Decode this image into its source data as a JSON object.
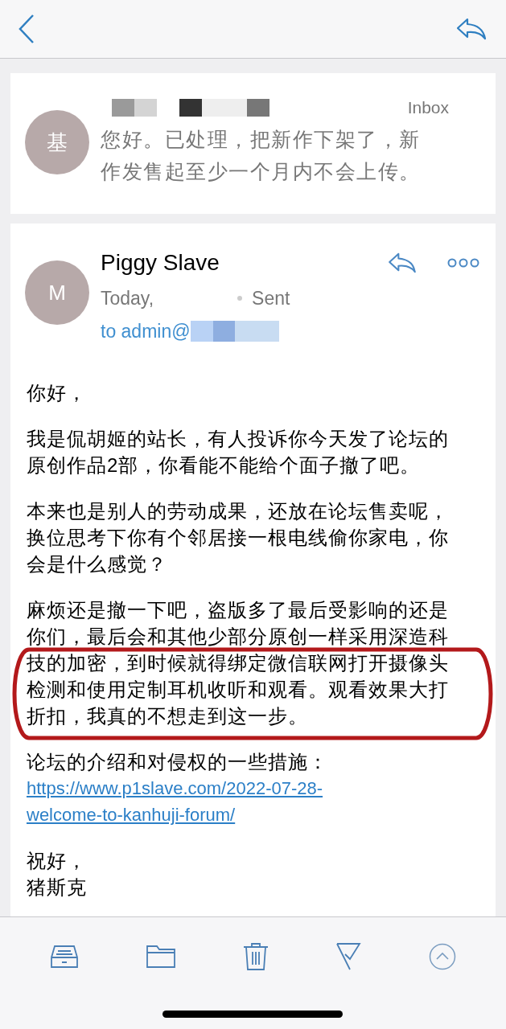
{
  "previous_message": {
    "avatar": "基",
    "folder": "Inbox",
    "preview": "您好。已处理，把新作下架了，新作发售起至少一个月内不会上传。"
  },
  "message": {
    "avatar": "M",
    "sender": "Piggy Slave",
    "date": "Today,",
    "folder": "Sent",
    "recipient": "to admin@",
    "paragraphs": [
      {
        "lines": [
          "你好，"
        ],
        "annotated": false
      },
      {
        "lines": [
          "我是侃胡姬的站长，有人投诉你今天发了论坛的原创作品2部，你看能不能给个面子撤了吧。"
        ],
        "annotated": false
      },
      {
        "lines": [
          "本来也是别人的劳动成果，还放在论坛售卖呢，换位思考下你有个邻居接一根电线偷你家电，你会是什么感觉？"
        ],
        "annotated": false
      },
      {
        "lines": [
          "麻烦还是撤一下吧，盗版多了最后受影响的还是你们，最后会和其他少部分原创一样采用深造科技的加密，到时候就得绑定微信联网打开摄像头检测和使用定制耳机收听和观看。观看效果大打折扣，我真的不想走到这一步。"
        ],
        "annotated": true
      },
      {
        "lines": [
          "论坛的介绍和对侵权的一些措施："
        ],
        "link": "https://www.p1slave.com/2022-07-28-welcome-to-kanhuji-forum/",
        "annotated": false
      },
      {
        "lines": [
          "祝好，",
          "猪斯克"
        ],
        "annotated": false
      }
    ]
  }
}
